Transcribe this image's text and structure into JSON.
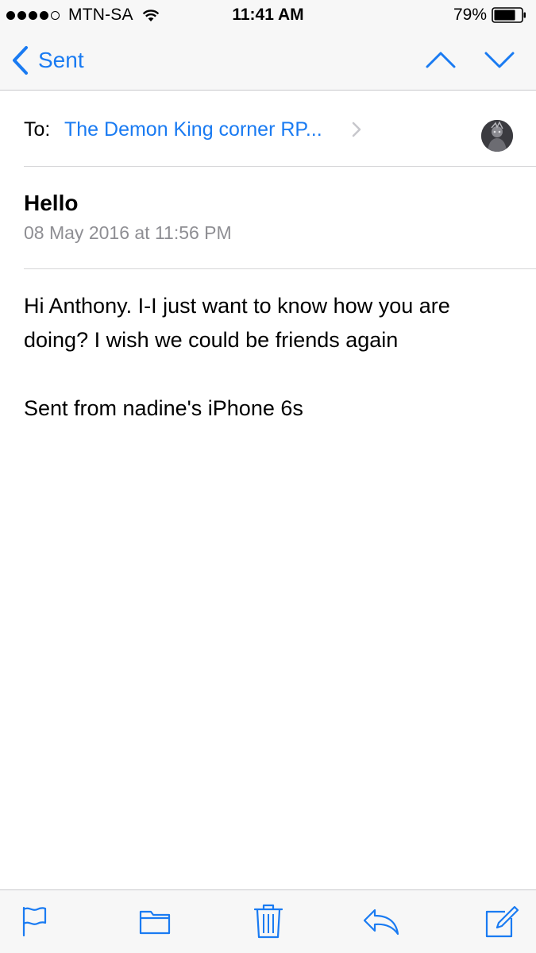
{
  "status_bar": {
    "carrier": "MTN-SA",
    "signal_bars_filled": 4,
    "signal_bars_total": 5,
    "time": "11:41 AM",
    "battery": "79%",
    "battery_level": 0.79
  },
  "nav": {
    "back_label": "Sent",
    "icons": [
      "chevron-left-icon",
      "chevron-up-icon",
      "chevron-down-icon"
    ]
  },
  "message": {
    "to_label": "To:",
    "recipient": "The Demon King corner RP...",
    "subject": "Hello",
    "date": "08 May 2016 at 11:56 PM",
    "body": "Hi Anthony. I-I just want to know how you are doing? I wish we could be friends again",
    "signature": "Sent from nadine's iPhone 6s"
  },
  "toolbar": {
    "icons": [
      "flag-icon",
      "folder-icon",
      "trash-icon",
      "reply-icon",
      "compose-icon"
    ]
  },
  "colors": {
    "accent": "#1a7bf2",
    "secondary_text": "#8e8e93",
    "bar_background": "#f7f7f7"
  }
}
